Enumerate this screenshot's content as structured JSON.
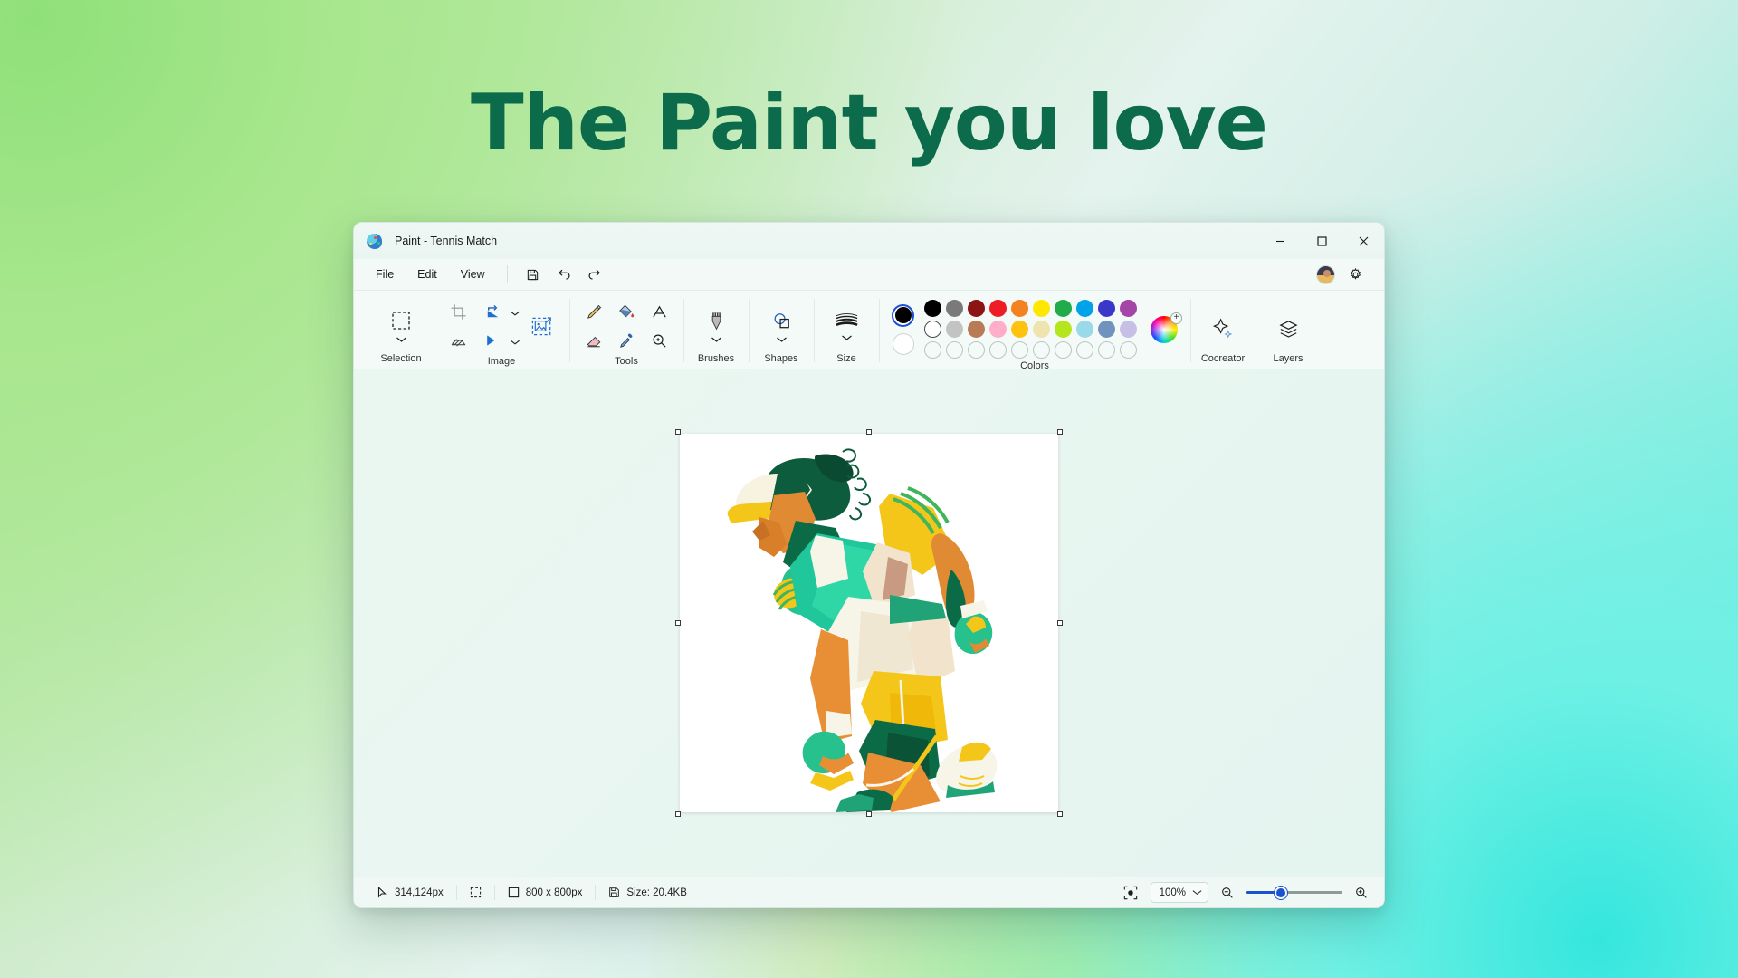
{
  "hero": {
    "headline": "The Paint you love"
  },
  "window": {
    "title": "Paint - Tennis Match",
    "app_icon": "paint-palette-icon",
    "controls": {
      "minimize": "minimize-icon",
      "maximize": "maximize-icon",
      "close": "close-icon"
    }
  },
  "menubar": {
    "items": [
      {
        "label": "File"
      },
      {
        "label": "Edit"
      },
      {
        "label": "View"
      }
    ],
    "icons": [
      {
        "name": "save-icon"
      },
      {
        "name": "undo-icon"
      },
      {
        "name": "redo-icon"
      }
    ],
    "account": "user-avatar",
    "settings": "gear-icon"
  },
  "ribbon": {
    "groups": [
      {
        "label": "Selection",
        "tools": [
          {
            "name": "rectangular-selection-icon"
          }
        ]
      },
      {
        "label": "Image",
        "tools": [
          {
            "name": "crop-icon"
          },
          {
            "name": "rotate-icon"
          },
          {
            "name": "flip-icon"
          },
          {
            "name": "resize-skew-icon"
          },
          {
            "name": "resize-image-icon"
          }
        ]
      },
      {
        "label": "Tools",
        "tools": [
          {
            "name": "pencil-icon"
          },
          {
            "name": "fill-bucket-icon"
          },
          {
            "name": "text-icon"
          },
          {
            "name": "eraser-icon"
          },
          {
            "name": "eyedropper-icon"
          },
          {
            "name": "magnifier-icon"
          }
        ]
      },
      {
        "label": "Brushes",
        "tools": [
          {
            "name": "brush-icon"
          }
        ]
      },
      {
        "label": "Shapes",
        "tools": [
          {
            "name": "shapes-icon"
          }
        ]
      },
      {
        "label": "Size",
        "tools": [
          {
            "name": "size-lines-icon"
          }
        ]
      },
      {
        "label": "Colors",
        "tools": []
      },
      {
        "label": "Cocreator",
        "tools": [
          {
            "name": "sparkle-icon"
          }
        ]
      },
      {
        "label": "Layers",
        "tools": [
          {
            "name": "layers-icon"
          }
        ]
      }
    ]
  },
  "colors": {
    "label": "Colors",
    "primary": "#000000",
    "secondary": "#ffffff",
    "row1": [
      "#000000",
      "#7a7a7a",
      "#8c1414",
      "#ee1c25",
      "#f58220",
      "#ffe800",
      "#22ab4b",
      "#00a2e8",
      "#3b37c8",
      "#a445a8"
    ],
    "row2": [
      "#ffffff",
      "#c3c3c3",
      "#b97a56",
      "#ffaec9",
      "#ffc20e",
      "#efe4b0",
      "#b5e61d",
      "#99d9ea",
      "#7092be",
      "#c8bfe7"
    ],
    "row3_empty_count": 10,
    "wheel": "color-wheel-icon",
    "wheel_add": "+"
  },
  "canvas": {
    "artwork_title": "tennis-player-illustration",
    "selected": true
  },
  "statusbar": {
    "cursor_position": "314,124px",
    "selection_icon": "selection-size-icon",
    "image_size": "800  x  800px",
    "file_size": "Size: 20.4KB",
    "fit_to_window": "fit-to-window-icon",
    "zoom_level": "100%",
    "zoom_out": "zoom-out-icon",
    "zoom_in": "zoom-in-icon",
    "zoom_slider_percent": 36
  }
}
